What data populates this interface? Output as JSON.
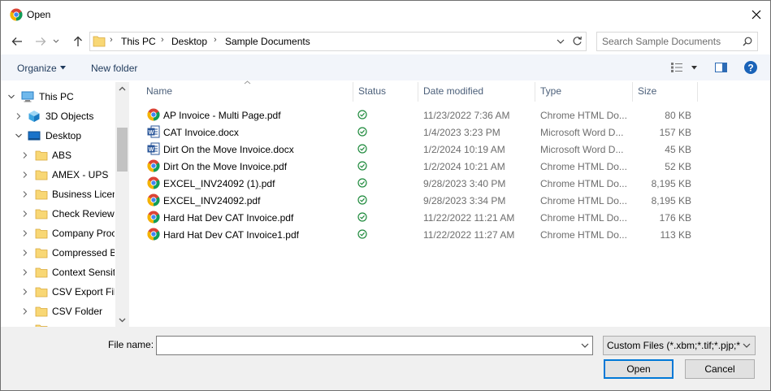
{
  "window": {
    "title": "Open"
  },
  "address": {
    "crumbs": [
      "This PC",
      "Desktop",
      "Sample Documents"
    ]
  },
  "search": {
    "placeholder": "Search Sample Documents"
  },
  "toolbar": {
    "organize_label": "Organize",
    "new_folder_label": "New folder"
  },
  "sidebar": {
    "items": [
      {
        "label": "This PC",
        "icon": "computer-icon",
        "expanded": true
      },
      {
        "label": "3D Objects",
        "icon": "3d-objects-icon",
        "expanded": false
      },
      {
        "label": "Desktop",
        "icon": "desktop-icon",
        "expanded": true
      },
      {
        "label": "ABS",
        "icon": "folder-icon"
      },
      {
        "label": "AMEX - UPS",
        "icon": "folder-icon"
      },
      {
        "label": "Business Licens",
        "icon": "folder-icon"
      },
      {
        "label": "Check Review",
        "icon": "folder-icon"
      },
      {
        "label": "Company Proc",
        "icon": "folder-icon"
      },
      {
        "label": "Compressed Bi",
        "icon": "folder-icon"
      },
      {
        "label": "Context Sensiti",
        "icon": "folder-icon"
      },
      {
        "label": "CSV Export File",
        "icon": "folder-icon"
      },
      {
        "label": "CSV Folder",
        "icon": "folder-icon"
      }
    ]
  },
  "columns": {
    "name": "Name",
    "status": "Status",
    "date": "Date modified",
    "type": "Type",
    "size": "Size"
  },
  "files": [
    {
      "name": "AP Invoice - Multi Page.pdf",
      "date": "11/23/2022 7:36 AM",
      "type": "Chrome HTML Do...",
      "size": "80 KB",
      "icon": "chrome-icon"
    },
    {
      "name": "CAT Invoice.docx",
      "date": "1/4/2023 3:23 PM",
      "type": "Microsoft Word D...",
      "size": "157 KB",
      "icon": "word-icon"
    },
    {
      "name": "Dirt On the Move Invoice.docx",
      "date": "1/2/2024 10:19 AM",
      "type": "Microsoft Word D...",
      "size": "45 KB",
      "icon": "word-icon"
    },
    {
      "name": "Dirt On the Move Invoice.pdf",
      "date": "1/2/2024 10:21 AM",
      "type": "Chrome HTML Do...",
      "size": "52 KB",
      "icon": "chrome-icon"
    },
    {
      "name": "EXCEL_INV24092 (1).pdf",
      "date": "9/28/2023 3:40 PM",
      "type": "Chrome HTML Do...",
      "size": "8,195 KB",
      "icon": "chrome-icon"
    },
    {
      "name": "EXCEL_INV24092.pdf",
      "date": "9/28/2023 3:34 PM",
      "type": "Chrome HTML Do...",
      "size": "8,195 KB",
      "icon": "chrome-icon"
    },
    {
      "name": "Hard Hat Dev CAT Invoice.pdf",
      "date": "11/22/2022 11:21 AM",
      "type": "Chrome HTML Do...",
      "size": "176 KB",
      "icon": "chrome-icon"
    },
    {
      "name": "Hard Hat Dev CAT Invoice1.pdf",
      "date": "11/22/2022 11:27 AM",
      "type": "Chrome HTML Do...",
      "size": "113 KB",
      "icon": "chrome-icon"
    }
  ],
  "footer": {
    "file_name_label": "File name:",
    "file_name_value": "",
    "filter_value": "Custom Files (*.xbm;*.tif;*.pjp;*",
    "open_label": "Open",
    "cancel_label": "Cancel"
  },
  "colors": {
    "accent": "#0078d7",
    "toolbar_text": "#1e395b",
    "status_green": "#1e8a3c"
  }
}
